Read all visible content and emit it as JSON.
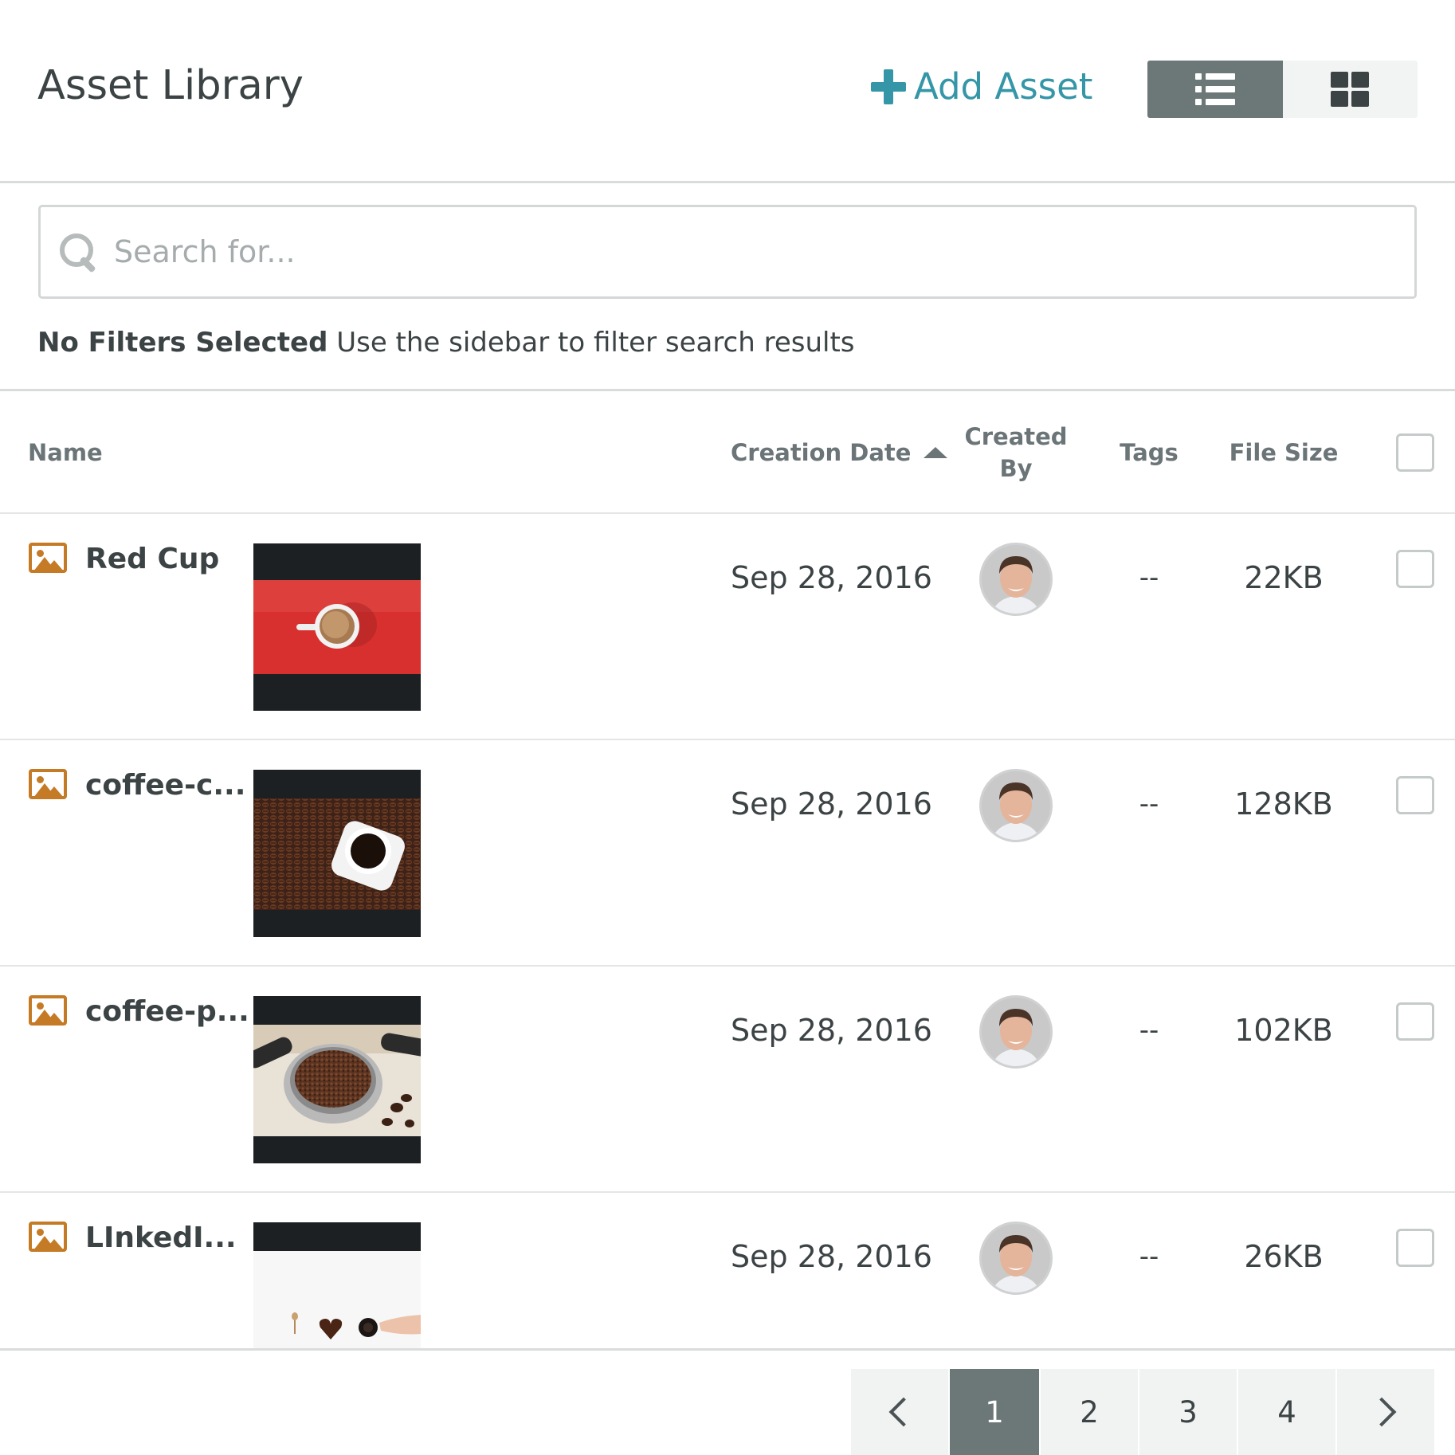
{
  "header": {
    "title": "Asset Library",
    "add_asset_label": "Add Asset"
  },
  "search": {
    "placeholder": "Search for..."
  },
  "filters": {
    "bold": "No Filters Selected",
    "text": "Use the sidebar to filter search results"
  },
  "table": {
    "columns": {
      "name": "Name",
      "creation_date": "Creation Date",
      "created_by_line1": "Created",
      "created_by_line2": "By",
      "tags": "Tags",
      "file_size": "File Size"
    },
    "rows": [
      {
        "name": "Red Cup",
        "date": "Sep 28, 2016",
        "tags": "--",
        "size": "22KB"
      },
      {
        "name": "coffee-c...",
        "date": "Sep 28, 2016",
        "tags": "--",
        "size": "128KB"
      },
      {
        "name": "coffee-p...",
        "date": "Sep 28, 2016",
        "tags": "--",
        "size": "102KB"
      },
      {
        "name": "LInkedI...",
        "date": "Sep 28, 2016",
        "tags": "--",
        "size": "26KB"
      }
    ]
  },
  "pagination": {
    "pages": [
      "1",
      "2",
      "3",
      "4"
    ],
    "current": "1"
  },
  "colors": {
    "accent": "#3596a8",
    "toggle_active": "#6c7777",
    "image_icon": "#c57a26"
  },
  "icons": [
    "plus-icon",
    "list-view-icon",
    "grid-view-icon",
    "search-icon",
    "image-file-icon",
    "sort-ascending-icon",
    "chevron-left-icon",
    "chevron-right-icon"
  ]
}
